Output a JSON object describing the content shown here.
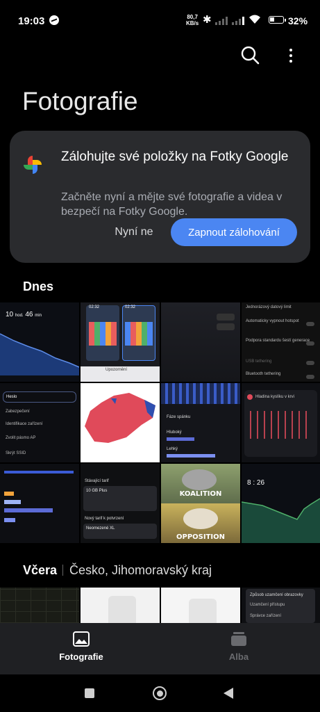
{
  "status_bar": {
    "time": "19:03",
    "speed_value": "80,7",
    "speed_unit": "KB/s",
    "battery_pct": "32%",
    "battery_level": 0.32
  },
  "header": {
    "title": "Fotografie",
    "search_icon": "search-icon",
    "more_icon": "more-vert-icon"
  },
  "backup_card": {
    "title": "Zálohujte své položky na Fotky Google",
    "description": "Začněte nyní a mějte své fotografie a videa v bezpečí na Fotky Google.",
    "dismiss_label": "Nyní ne",
    "confirm_label": "Zapnout zálohování",
    "logo": "google-photos-pinwheel",
    "accent": "#4b86f2"
  },
  "sections": {
    "today": "Dnes",
    "yesterday": "Včera",
    "yesterday_location": "Česko, Jihomoravský kraj"
  },
  "thumbnails": {
    "t1_time": "10",
    "t1_h": "hod.",
    "t1_m": "46",
    "t1_min": "min",
    "t2_time_a": "02:32",
    "t2_time_b": "02:32",
    "t2_label": "Upozornění",
    "t4_row1": "Jednorázový datový limit",
    "t4_row2": "Automaticky vypnout hotspot",
    "t4_row3": "Podpora standardu šestí generace",
    "t4_row4": "USB tethering",
    "t4_row5": "Bluetooth tethering",
    "t5_row1": "Heslo",
    "t5_row2": "Zabezpečení",
    "t5_row3": "Identifikace zařízení",
    "t5_row4": "Zvolit pásmo AP",
    "t5_row5": "Skrýt SSID",
    "t7_label1": "Fáze spánku",
    "t7_label2": "Hluboký",
    "t7_label3": "Lehký",
    "t8_label": "Hladina kyslíku v krvi",
    "t10_label1": "Stávající tarif",
    "t10_label2": "10 GB Plus",
    "t10_label3": "Nový tarif k potvrzení",
    "t10_label4": "Neomezené XL",
    "t11_top": "KOALITION",
    "t11_bottom": "OPPOSITION",
    "t12_time": "8",
    "t12_min": "26",
    "y4_label1": "Způsob uzamčení obrazovky",
    "y4_label2": "Uzamčení přístupu",
    "y4_label3": "Správce zařízení"
  },
  "bottom_nav": {
    "photos_label": "Fotografie",
    "albums_label": "Alba",
    "photos_icon": "photo-icon",
    "albums_icon": "album-stack-icon"
  },
  "system_nav": {
    "recents_icon": "square-icon",
    "home_icon": "circle-home-icon",
    "back_icon": "triangle-back-icon"
  }
}
